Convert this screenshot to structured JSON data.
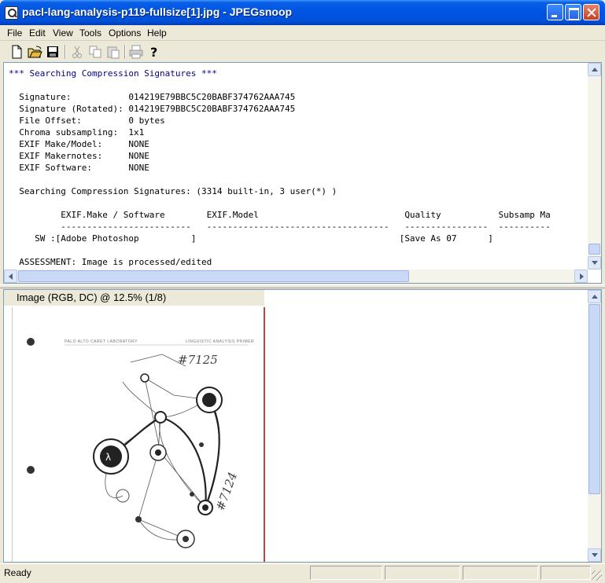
{
  "window": {
    "title": "pacl-lang-analysis-p119-fullsize[1].jpg - JPEGsnoop"
  },
  "menu": [
    "File",
    "Edit",
    "View",
    "Tools",
    "Options",
    "Help"
  ],
  "toolbar": {
    "buttons": [
      "new-icon",
      "open-icon",
      "save-icon",
      "cut-icon",
      "copy-icon",
      "paste-icon",
      "print-icon",
      "help-icon"
    ]
  },
  "log": {
    "heading": "*** Searching Compression Signatures ***",
    "fields": [
      {
        "label": "  Signature:           ",
        "value": "014219E79BBC5C20BABF374762AAA745"
      },
      {
        "label": "  Signature (Rotated): ",
        "value": "014219E79BBC5C20BABF374762AAA745"
      },
      {
        "label": "  File Offset:         ",
        "value": "0 bytes"
      },
      {
        "label": "  Chroma subsampling:  ",
        "value": "1x1"
      },
      {
        "label": "  EXIF Make/Model:     ",
        "value": "NONE"
      },
      {
        "label": "  EXIF Makernotes:     ",
        "value": "NONE"
      },
      {
        "label": "  EXIF Software:       ",
        "value": "NONE"
      }
    ],
    "search_line": "  Searching Compression Signatures: (3314 built-in, 3 user(*) )",
    "table_header": "          EXIF.Make / Software        EXIF.Model                            Quality           Subsamp Ma",
    "table_rule": "          -------------------------   -----------------------------------   ----------------  ----------",
    "table_row": "     SW :[Adobe Photoshop          ]                                       [Save As 07      ]",
    "assessment": "  ASSESSMENT: Image is processed/edited"
  },
  "image_pane": {
    "label": "Image (RGB, DC) @ 12.5% (1/8)",
    "doc_header_left": "PALO ALTO CARET LABORATORY",
    "doc_header_right": "LINGUISTIC ANALYSIS PRIMER",
    "annotation_1": "#7125",
    "annotation_2": "#7124"
  },
  "status": {
    "text": "Ready"
  },
  "colors": {
    "titlebar": "#0054e3",
    "log_heading": "#00008b",
    "window_bg": "#ece9d8"
  }
}
